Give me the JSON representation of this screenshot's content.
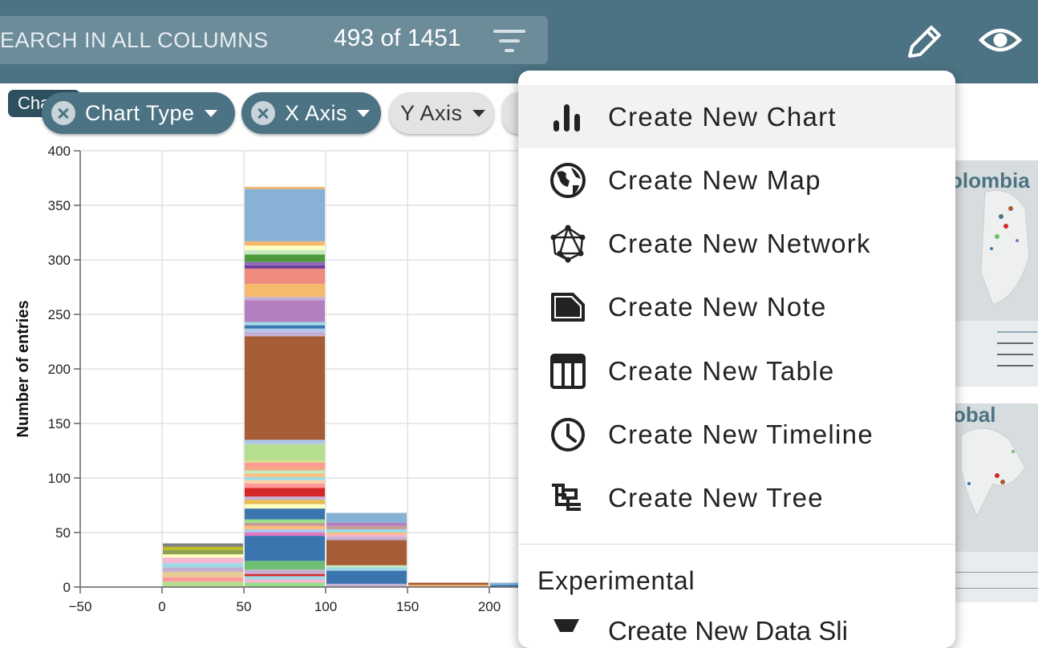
{
  "header": {
    "search_placeholder": "EARCH IN ALL COLUMNS",
    "row_count": "493",
    "row_count_of": "of",
    "row_total": "1451",
    "icons": {
      "filter": "filter-icon",
      "edit": "pencil-icon",
      "view": "eye-icon"
    },
    "colors": {
      "bar": "#4c7383"
    }
  },
  "chips": {
    "tag": "Chart",
    "chart_type": "Chart Type",
    "x_axis": "X Axis",
    "y_axis": "Y Axis"
  },
  "menu": {
    "items": [
      {
        "label": "Create New Chart",
        "icon": "bar-chart-icon"
      },
      {
        "label": "Create New Map",
        "icon": "globe-icon"
      },
      {
        "label": "Create New Network",
        "icon": "network-icon"
      },
      {
        "label": "Create New Note",
        "icon": "note-icon"
      },
      {
        "label": "Create New Table",
        "icon": "table-icon"
      },
      {
        "label": "Create New Timeline",
        "icon": "clock-icon"
      },
      {
        "label": "Create New Tree",
        "icon": "tree-icon"
      }
    ],
    "section_title": "Experimental",
    "partial_item": "Create New Data Sli"
  },
  "thumbnails": {
    "colombia": "olombia",
    "global": "obal"
  },
  "chart_data": {
    "type": "bar",
    "ylabel": "Number of entries",
    "xlabel": "",
    "ylim": [
      0,
      400
    ],
    "xlim": [
      -50,
      220
    ],
    "x_ticks": [
      -50,
      0,
      50,
      100,
      150,
      200
    ],
    "y_ticks": [
      0,
      50,
      100,
      150,
      200,
      250,
      300,
      350,
      400
    ],
    "bins": [
      {
        "x0": 0,
        "x1": 50,
        "total": 40,
        "segments": [
          [
            5,
            "#b5de8e"
          ],
          [
            4,
            "#ff9999"
          ],
          [
            5,
            "#e7cb94"
          ],
          [
            4,
            "#c5b0d5"
          ],
          [
            4,
            "#9edae5"
          ],
          [
            5,
            "#f7b6d2"
          ],
          [
            3,
            "#ffffbf"
          ],
          [
            4,
            "#8ca252"
          ],
          [
            3,
            "#bcbd22"
          ],
          [
            3,
            "#7f7f7f"
          ]
        ]
      },
      {
        "x0": 50,
        "x1": 100,
        "total": 380,
        "segments": [
          [
            4,
            "#98df8a"
          ],
          [
            3,
            "#f7b6d2"
          ],
          [
            3,
            "#9edae5"
          ],
          [
            2,
            "#d62728"
          ],
          [
            4,
            "#c5b0d5"
          ],
          [
            8,
            "#6fbf73"
          ],
          [
            23,
            "#3a75b0"
          ],
          [
            3,
            "#e377c2"
          ],
          [
            3,
            "#aec7e8"
          ],
          [
            3,
            "#ffbb78"
          ],
          [
            3,
            "#c49c94"
          ],
          [
            3,
            "#98df8a"
          ],
          [
            10,
            "#3a75b0"
          ],
          [
            4,
            "#ffffbf"
          ],
          [
            4,
            "#e7ba52"
          ],
          [
            3,
            "#c5b0d5"
          ],
          [
            8,
            "#d62728"
          ],
          [
            4,
            "#ff9999"
          ],
          [
            3,
            "#fdd0a2"
          ],
          [
            3,
            "#9edae5"
          ],
          [
            3,
            "#ffbb78"
          ],
          [
            3,
            "#c7e9c0"
          ],
          [
            3,
            "#f4a582"
          ],
          [
            4,
            "#ff9896"
          ],
          [
            2,
            "#dbdb8d"
          ],
          [
            15,
            "#b5de8e"
          ],
          [
            4,
            "#aec7e8"
          ],
          [
            95,
            "#a65d35"
          ],
          [
            4,
            "#c5b0d5"
          ],
          [
            3,
            "#aec7e8"
          ],
          [
            3,
            "#3a75b0"
          ],
          [
            3,
            "#9edae5"
          ],
          [
            20,
            "#b47fbf"
          ],
          [
            3,
            "#c5b0d5"
          ],
          [
            12,
            "#f6ba6f"
          ],
          [
            14,
            "#f08a7e"
          ],
          [
            3,
            "#6a3d9a"
          ],
          [
            3,
            "#9467bd"
          ],
          [
            7,
            "#4c9a3c"
          ],
          [
            4,
            "#c7e9c0"
          ],
          [
            4,
            "#ffffbf"
          ],
          [
            4,
            "#f6ba6f"
          ],
          [
            48,
            "#87b2d6"
          ],
          [
            2,
            "#f6ba6f"
          ]
        ]
      },
      {
        "x0": 100,
        "x1": 150,
        "total": 68,
        "segments": [
          [
            3,
            "#c5b0d5"
          ],
          [
            12,
            "#3a75b0"
          ],
          [
            3,
            "#9edae5"
          ],
          [
            2,
            "#c7e9c0"
          ],
          [
            23,
            "#a65d35"
          ],
          [
            3,
            "#c5b0d5"
          ],
          [
            2,
            "#f7b6d2"
          ],
          [
            2,
            "#ffbb78"
          ],
          [
            3,
            "#9edae5"
          ],
          [
            3,
            "#c49c94"
          ],
          [
            3,
            "#b47fbf"
          ],
          [
            9,
            "#87b2d6"
          ]
        ]
      },
      {
        "x0": 150,
        "x1": 200,
        "total": 4,
        "segments": [
          [
            2,
            "#f6ba6f"
          ],
          [
            2,
            "#a65d35"
          ]
        ]
      },
      {
        "x0": 200,
        "x1": 250,
        "total": 4,
        "segments": [
          [
            2,
            "#3a75b0"
          ],
          [
            2,
            "#87b2d6"
          ]
        ]
      }
    ]
  }
}
